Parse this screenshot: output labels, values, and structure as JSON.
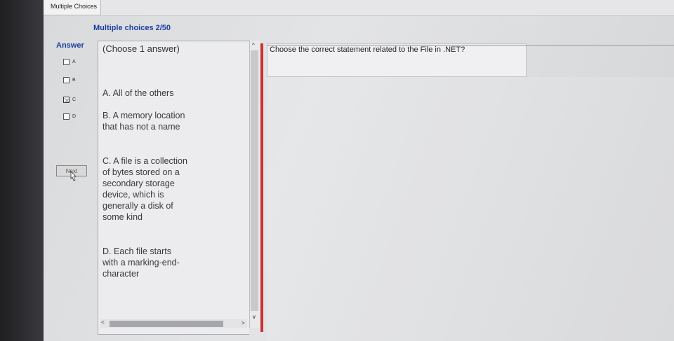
{
  "window": {
    "title": "Multiple Choices"
  },
  "quiz": {
    "counter": "Multiple choices 2/50",
    "answer_label": "Answer",
    "choose_hint": "(Choose 1 answer)",
    "question": "Choose the correct statement related to the File in .NET?",
    "next_label": "Next"
  },
  "answers": [
    {
      "letter": "A",
      "checked": false
    },
    {
      "letter": "B",
      "checked": false
    },
    {
      "letter": "C",
      "checked": true
    },
    {
      "letter": "D",
      "checked": false
    }
  ],
  "choices": [
    {
      "text": "A. All of the others"
    },
    {
      "text": "B. A memory location that has not a name"
    },
    {
      "text": "C. A file is a collection of bytes stored on a secondary storage device, which is generally a disk of some kind"
    },
    {
      "text": "D. Each file starts with a marking-end-character"
    }
  ],
  "colors": {
    "accent": "#1c3e9e",
    "divider": "#cc3030"
  },
  "icons": [
    "checkbox-icon",
    "pointer-cursor-icon",
    "scroll-up-icon",
    "scroll-down-icon",
    "scroll-left-icon",
    "scroll-right-icon"
  ]
}
